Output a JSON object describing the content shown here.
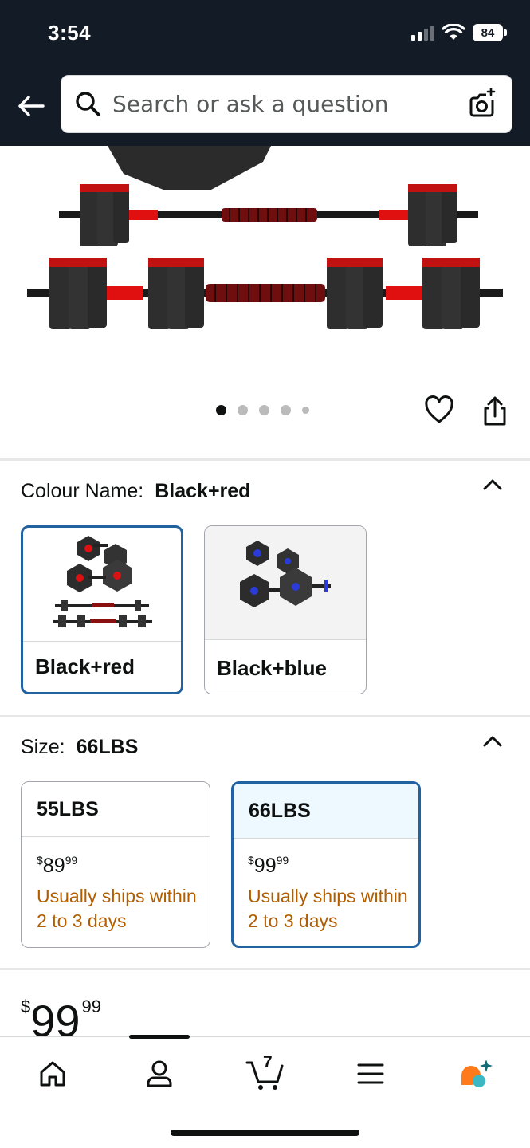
{
  "status_bar": {
    "time": "3:54",
    "battery": "84"
  },
  "search": {
    "placeholder": "Search or ask a question"
  },
  "carousel": {
    "dot_count": 5,
    "active_index": 0
  },
  "colour": {
    "label": "Colour Name:",
    "selected": "Black+red",
    "options": [
      {
        "label": "Black+red",
        "selected": true
      },
      {
        "label": "Black+blue",
        "selected": false
      }
    ]
  },
  "size": {
    "label": "Size:",
    "selected": "66LBS",
    "options": [
      {
        "label": "55LBS",
        "currency": "$",
        "price_whole": "89",
        "price_frac": "99",
        "shipping": "Usually ships within 2 to 3 days",
        "selected": false
      },
      {
        "label": "66LBS",
        "currency": "$",
        "price_whole": "99",
        "price_frac": "99",
        "shipping": "Usually ships within 2 to 3 days",
        "selected": true
      }
    ]
  },
  "price": {
    "currency": "$",
    "whole": "99",
    "fraction": "99"
  },
  "bottom_nav": {
    "items": [
      "home-icon",
      "account-icon",
      "cart-icon",
      "menu-icon",
      "rufus-ai-icon"
    ],
    "cart_count": "7"
  },
  "colors": {
    "header_bg": "#131b26",
    "selected_border": "#2162a1",
    "shipping_text": "#b25e00",
    "rufus_orange": "#ff7a1a",
    "rufus_teal": "#3bb8c4"
  }
}
